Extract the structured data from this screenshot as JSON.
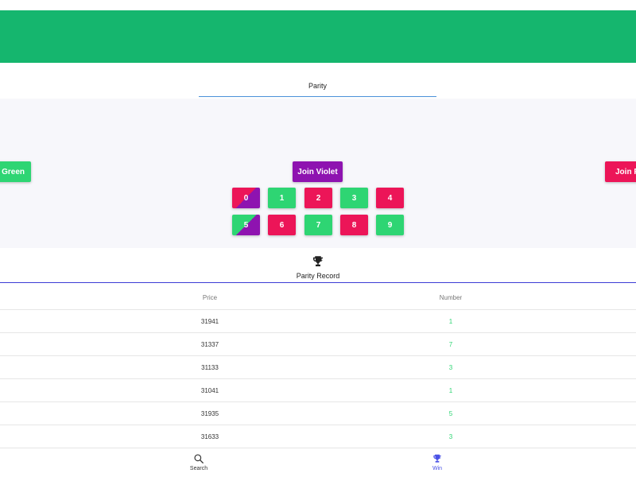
{
  "colors": {
    "brand_green": "#15b66e",
    "tab_underline": "#4a90d9",
    "record_line": "#3b3bd6",
    "green": "#2ed573",
    "red": "#ec1558",
    "violet": "#8e13b0",
    "number_green": "#2ed573",
    "nav_active": "#4a52e6",
    "nav_inactive": "#333333"
  },
  "tabs": {
    "active_label": "Parity"
  },
  "join": {
    "green_label": "Join Green",
    "violet_label": "Join Violet",
    "red_label": "Join Red"
  },
  "numbers": [
    {
      "label": "0",
      "style": "red-violet"
    },
    {
      "label": "1",
      "style": "green"
    },
    {
      "label": "2",
      "style": "red"
    },
    {
      "label": "3",
      "style": "green"
    },
    {
      "label": "4",
      "style": "red"
    },
    {
      "label": "5",
      "style": "green-violet"
    },
    {
      "label": "6",
      "style": "red"
    },
    {
      "label": "7",
      "style": "green"
    },
    {
      "label": "8",
      "style": "red"
    },
    {
      "label": "9",
      "style": "green"
    }
  ],
  "record": {
    "icon": "trophy-icon",
    "title": "Parity Record",
    "columns": {
      "price": "Price",
      "number": "Number"
    },
    "rows": [
      {
        "price": "31941",
        "number": "1"
      },
      {
        "price": "31337",
        "number": "7"
      },
      {
        "price": "31133",
        "number": "3"
      },
      {
        "price": "31041",
        "number": "1"
      },
      {
        "price": "31935",
        "number": "5"
      },
      {
        "price": "31633",
        "number": "3"
      }
    ]
  },
  "nav": {
    "search_label": "Search",
    "search_icon": "search-icon",
    "win_label": "Win",
    "win_icon": "trophy-icon"
  }
}
